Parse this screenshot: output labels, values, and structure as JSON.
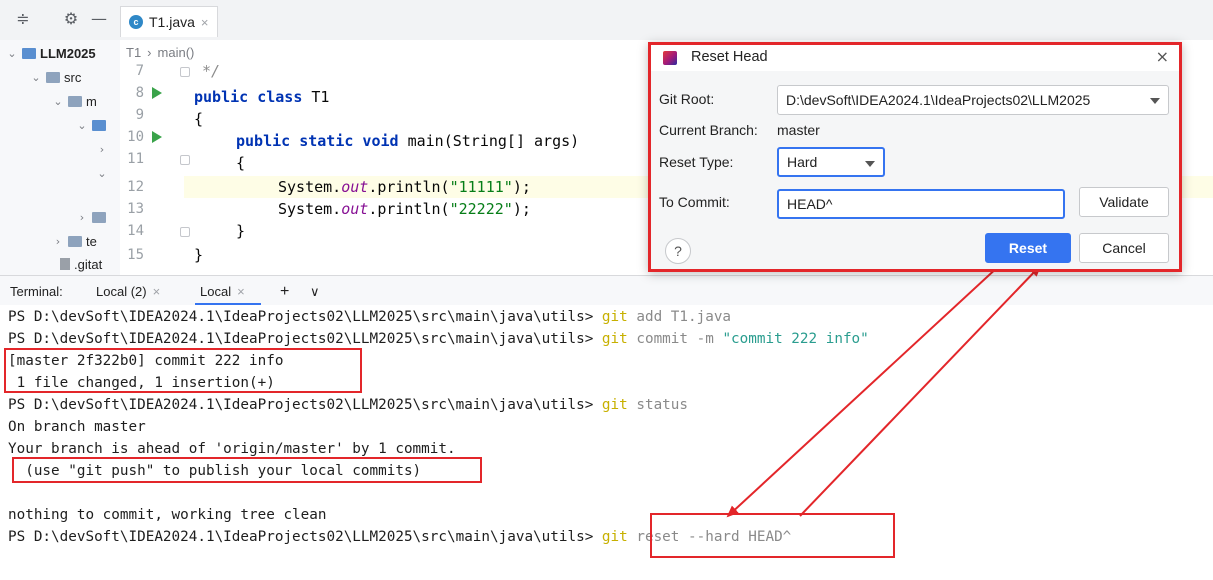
{
  "toolbar": {
    "icons": [
      "collapse-icon",
      "gear-icon",
      "minimize-icon"
    ],
    "file_tab": "T1.java",
    "file_tab_close": "×"
  },
  "tree": {
    "project": "LLM2025",
    "src": "src",
    "main": "m",
    "test": "te",
    "gitattr": ".gitat"
  },
  "editor": {
    "breadcrumb_class": "T1",
    "breadcrumb_sep": "›",
    "breadcrumb_method": "main()",
    "line_numbers": [
      "7",
      "8",
      "9",
      "10",
      "11",
      "12",
      "13",
      "14",
      "15"
    ],
    "comment": "*/",
    "class_decl_kw": "public class",
    "class_name": " T1",
    "brace_open": "{",
    "main_kw": "public static void",
    "main_sig": " main(String[] args)",
    "inner_brace_open": "{",
    "sys": "System.",
    "out": "out",
    "println": ".println(",
    "str1": "\"11111\"",
    "str2": "\"22222\"",
    "end": ");",
    "inner_brace_close": "}",
    "brace_close": "}"
  },
  "terminal_tabs": {
    "label": "Terminal:",
    "tab1": "Local (2)",
    "tab2": "Local",
    "close": "×",
    "add": "+",
    "more": "∨"
  },
  "terminal": {
    "prompt": "PS D:\\devSoft\\IDEA2024.1\\IdeaProjects02\\LLM2025\\src\\main\\java\\utils>",
    "git": "git",
    "cmd_add": " add T1.java",
    "cmd_commit": " commit -m ",
    "commit_msg": "\"commit 222 info\"",
    "out_commit1": "[master 2f322b0] commit 222 info",
    "out_commit2": " 1 file changed, 1 insertion(+)",
    "cmd_status": " status",
    "out_status1": "On branch master",
    "out_status2": "Your branch is ahead of 'origin/master' by 1 commit.",
    "out_status3": "  (use \"git push\" to publish your local commits)",
    "out_status4": "nothing to commit, working tree clean",
    "cmd_reset": " reset --hard HEAD^"
  },
  "dialog": {
    "title": "Reset Head",
    "close": "×",
    "git_root_label": "Git Root:",
    "git_root_value": "D:\\devSoft\\IDEA2024.1\\IdeaProjects02\\LLM2025",
    "current_branch_label": "Current Branch:",
    "current_branch_value": "master",
    "reset_type_label": "Reset Type:",
    "reset_type_value": "Hard",
    "to_commit_label": "To Commit:",
    "to_commit_value": "HEAD^",
    "validate": "Validate",
    "help": "?",
    "reset": "Reset",
    "cancel": "Cancel"
  },
  "colors": {
    "annotation_red": "#e3262a",
    "primary_blue": "#3574f0",
    "git_yellow": "#c7b000"
  }
}
